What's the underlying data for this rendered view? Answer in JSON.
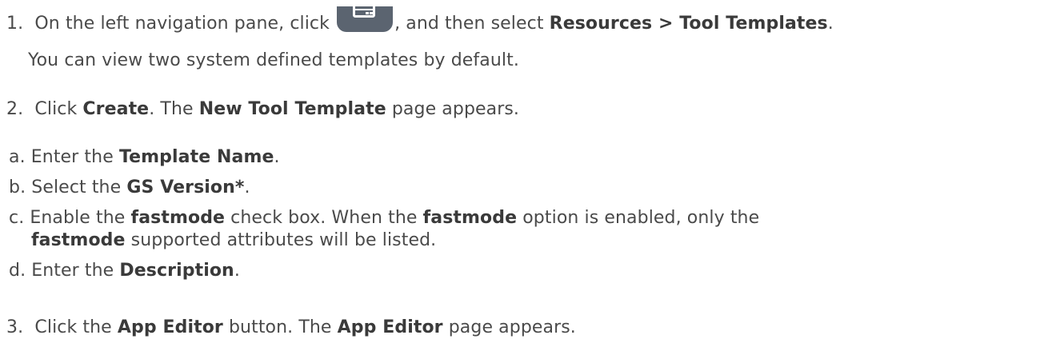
{
  "steps": {
    "s1": {
      "num": "1.",
      "pre": "On the left navigation pane, click",
      "post": ", and then select",
      "bold": "Resources > Tool Templates",
      "end": "."
    },
    "s1_note": "You can view two system defined templates by default.",
    "s2": {
      "num": "2.",
      "t1": "Click",
      "b1": "Create",
      "t2": ". The",
      "b2": "New Tool Template",
      "t3": "page appears."
    },
    "sa": {
      "num": "a.",
      "t1": "Enter the",
      "b1": "Template Name",
      "t2": "."
    },
    "sb": {
      "num": "b.",
      "t1": "Select the",
      "b1": "GS Version*",
      "t2": "."
    },
    "sc": {
      "num": "c.",
      "t1": "Enable the",
      "b1": "fastmode",
      "t2": "check box. When the",
      "b2": "fastmode",
      "t3": "option is enabled, only the",
      "b3": "fastmode",
      "t4": "supported attributes will be listed."
    },
    "sd": {
      "num": "d.",
      "t1": "Enter the",
      "b1": "Description",
      "t2": "."
    },
    "s3": {
      "num": "3.",
      "t1": "Click the",
      "b1": "App Editor",
      "t2": "button. The",
      "b2": "App Editor",
      "t3": "page appears."
    }
  },
  "icons": {
    "nav_icon": "server-panel-icon"
  },
  "colors": {
    "text": "#4a4a4a",
    "bold_text": "#3a3a3a",
    "icon_bg": "#5b6470"
  }
}
